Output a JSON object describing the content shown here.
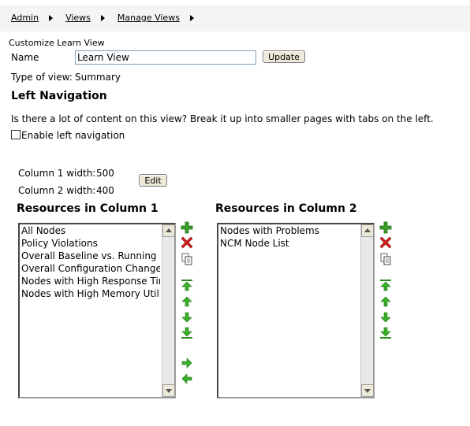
{
  "breadcrumb": [
    "Admin",
    "Views",
    "Manage Views"
  ],
  "page_title": "Customize Learn View",
  "name_field": {
    "label": "Name",
    "value": "Learn View"
  },
  "update_button": "Update",
  "type_of_view": {
    "label": "Type of view:",
    "value": "Summary"
  },
  "left_navigation": {
    "heading": "Left Navigation",
    "description": "Is there a lot of content on this view? Break it up into smaller pages with tabs on the left.",
    "checkbox_label": "Enable left navigation",
    "checked": false
  },
  "columns": {
    "col1_label": "Column 1 width:",
    "col1_value": "500",
    "col2_label": "Column 2 width:",
    "col2_value": "400",
    "edit_button": "Edit"
  },
  "resources_col1": {
    "heading": "Resources in Column 1",
    "items": [
      "All Nodes",
      "Policy Violations",
      "Overall Baseline vs. Running Cor",
      "Overall Configuration Changes S",
      "Nodes with High Response Time",
      "Nodes with High Memory Utilizati"
    ]
  },
  "resources_col2": {
    "heading": "Resources in Column 2",
    "items": [
      "Nodes with Problems",
      "NCM Node List"
    ]
  },
  "icons": [
    "add-icon",
    "delete-icon",
    "copy-icon",
    "move-top-icon",
    "move-up-icon",
    "move-down-icon",
    "move-bottom-icon",
    "move-right-icon",
    "move-left-icon"
  ],
  "colors": {
    "add": "#3aa02a",
    "delete": "#d42020",
    "arrow": "#3ab02a"
  }
}
